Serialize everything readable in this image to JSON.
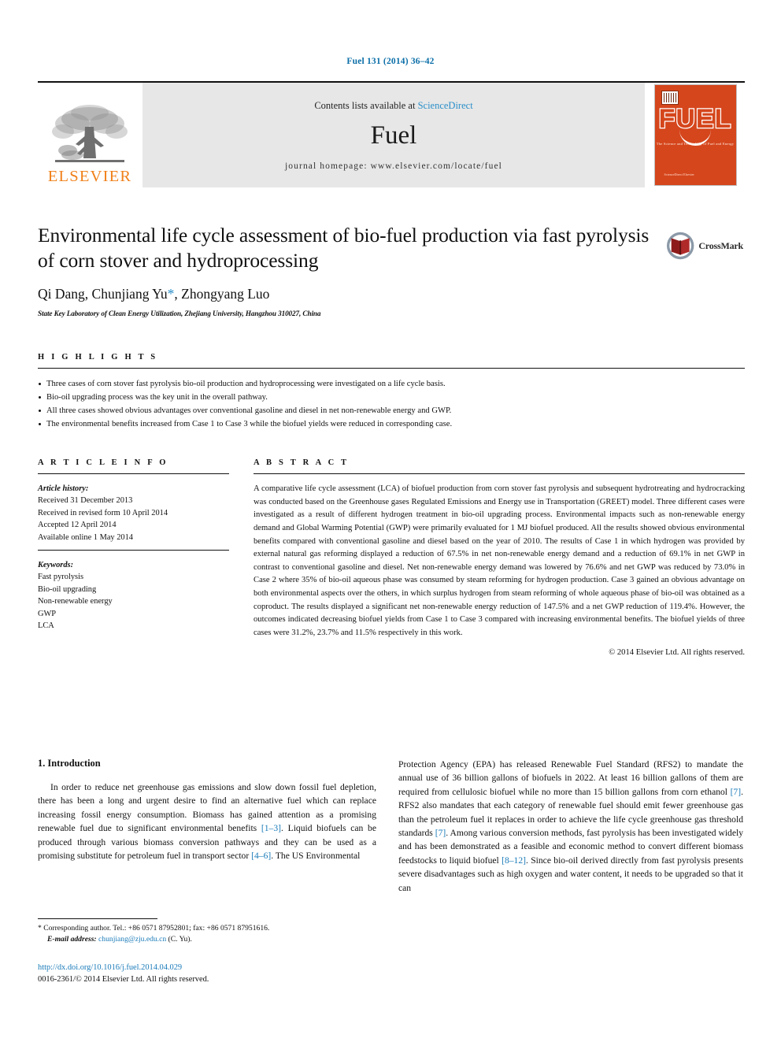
{
  "running_head": "Fuel 131 (2014) 36–42",
  "masthead": {
    "publisher": "ELSEVIER",
    "contents_prefix": "Contents lists available at",
    "contents_link": "ScienceDirect",
    "journal_title": "Fuel",
    "homepage": "journal homepage: www.elsevier.com/locate/fuel",
    "cover_wordmark": "FUEL",
    "cover_subtitle": "The Science and Technology of Fuel and Energy",
    "cover_footer": "ScienceDirect\nElsevier"
  },
  "article": {
    "title": "Environmental life cycle assessment of bio-fuel production via fast pyrolysis of corn stover and hydroprocessing",
    "authors": "Qi Dang, Chunjiang Yu",
    "author_marker": "*",
    "authors_tail": ", Zhongyang Luo",
    "affiliation": "State Key Laboratory of Clean Energy Utilization, Zhejiang University, Hangzhou 310027, China",
    "crossmark_label": "CrossMark"
  },
  "highlights": {
    "heading": "H I G H L I G H T S",
    "items": [
      "Three cases of corn stover fast pyrolysis bio-oil production and hydroprocessing were investigated on a life cycle basis.",
      "Bio-oil upgrading process was the key unit in the overall pathway.",
      "All three cases showed obvious advantages over conventional gasoline and diesel in net non-renewable energy and GWP.",
      "The environmental benefits increased from Case 1 to Case 3 while the biofuel yields were reduced in corresponding case."
    ]
  },
  "article_info": {
    "heading": "A R T I C L E   I N F O",
    "history_label": "Article history:",
    "history": [
      "Received 31 December 2013",
      "Received in revised form 10 April 2014",
      "Accepted 12 April 2014",
      "Available online 1 May 2014"
    ],
    "keywords_label": "Keywords:",
    "keywords": [
      "Fast pyrolysis",
      "Bio-oil upgrading",
      "Non-renewable energy",
      "GWP",
      "LCA"
    ]
  },
  "abstract": {
    "heading": "A B S T R A C T",
    "text": "A comparative life cycle assessment (LCA) of biofuel production from corn stover fast pyrolysis and subsequent hydrotreating and hydrocracking was conducted based on the Greenhouse gases Regulated Emissions and Energy use in Transportation (GREET) model. Three different cases were investigated as a result of different hydrogen treatment in bio-oil upgrading process. Environmental impacts such as non-renewable energy demand and Global Warming Potential (GWP) were primarily evaluated for 1 MJ biofuel produced. All the results showed obvious environmental benefits compared with conventional gasoline and diesel based on the year of 2010. The results of Case 1 in which hydrogen was provided by external natural gas reforming displayed a reduction of 67.5% in net non-renewable energy demand and a reduction of 69.1% in net GWP in contrast to conventional gasoline and diesel. Net non-renewable energy demand was lowered by 76.6% and net GWP was reduced by 73.0% in Case 2 where 35% of bio-oil aqueous phase was consumed by steam reforming for hydrogen production. Case 3 gained an obvious advantage on both environmental aspects over the others, in which surplus hydrogen from steam reforming of whole aqueous phase of bio-oil was obtained as a coproduct. The results displayed a significant net non-renewable energy reduction of 147.5% and a net GWP reduction of 119.4%. However, the outcomes indicated decreasing biofuel yields from Case 1 to Case 3 compared with increasing environmental benefits. The biofuel yields of three cases were 31.2%, 23.7% and 11.5% respectively in this work.",
    "copyright": "© 2014 Elsevier Ltd. All rights reserved."
  },
  "body": {
    "section_title": "1. Introduction",
    "left_paragraph_part1": "In order to reduce net greenhouse gas emissions and slow down fossil fuel depletion, there has been a long and urgent desire to find an alternative fuel which can replace increasing fossil energy consumption. Biomass has gained attention as a promising renewable fuel due to significant environmental benefits ",
    "ref_1_3": "[1–3]",
    "left_paragraph_part2": ". Liquid biofuels can be produced through various biomass conversion pathways and they can be used as a promising substitute for petroleum fuel in transport sector ",
    "ref_4_6": "[4–6]",
    "left_paragraph_part3": ". The US Environmental",
    "right_paragraph_part1": "Protection Agency (EPA) has released Renewable Fuel Standard (RFS2) to mandate the annual use of 36 billion gallons of biofuels in 2022. At least 16 billion gallons of them are required from cellulosic biofuel while no more than 15 billion gallons from corn ethanol ",
    "ref_7a": "[7]",
    "right_paragraph_part2": ". RFS2 also mandates that each category of renewable fuel should emit fewer greenhouse gas than the petroleum fuel it replaces in order to achieve the life cycle greenhouse gas threshold standards ",
    "ref_7b": "[7]",
    "right_paragraph_part3": ". Among various conversion methods, fast pyrolysis has been investigated widely and has been demonstrated as a feasible and economic method to convert different biomass feedstocks to liquid biofuel ",
    "ref_8_12": "[8–12]",
    "right_paragraph_part4": ". Since bio-oil derived directly from fast pyrolysis presents severe disadvantages such as high oxygen and water content, it needs to be upgraded so that it can"
  },
  "footnotes": {
    "corresponding_marker": "*",
    "corresponding_text": "Corresponding author. Tel.: +86 0571 87952801; fax: +86 0571 87951616.",
    "email_label": "E-mail address:",
    "email": "chunjiang@zju.edu.cn",
    "email_attrib": "(C. Yu).",
    "doi": "http://dx.doi.org/10.1016/j.fuel.2014.04.029",
    "issn_line": "0016-2361/© 2014 Elsevier Ltd. All rights reserved."
  },
  "colors": {
    "link_blue": "#1a7bb9",
    "elsevier_orange": "#f08019",
    "cover_red": "#d5461c"
  }
}
